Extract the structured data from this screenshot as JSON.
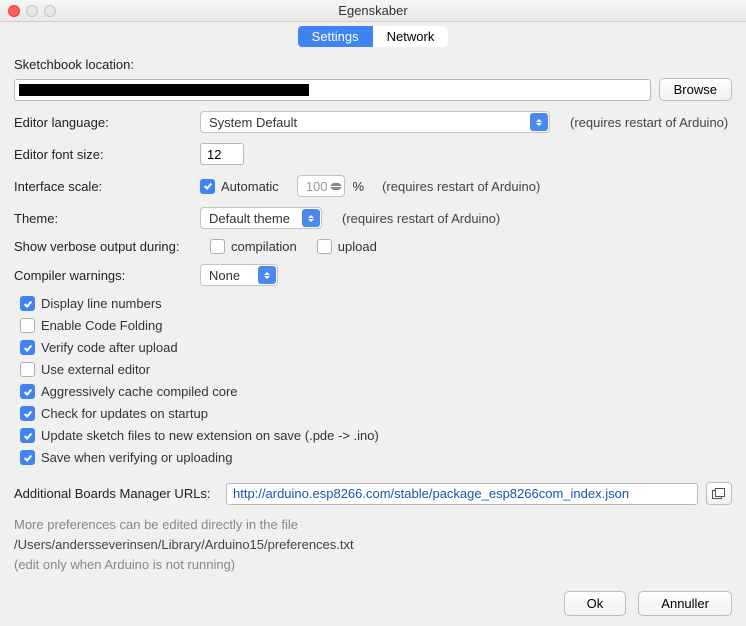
{
  "window": {
    "title": "Egenskaber"
  },
  "tabs": {
    "settings": "Settings",
    "network": "Network"
  },
  "sketchbook": {
    "label": "Sketchbook location:",
    "browse": "Browse"
  },
  "lang": {
    "label": "Editor language:",
    "value": "System Default",
    "hint": "(requires restart of Arduino)"
  },
  "font": {
    "label": "Editor font size:",
    "value": "12"
  },
  "scale": {
    "label": "Interface scale:",
    "auto_label": "Automatic",
    "pct": "100",
    "pct_suffix": "%",
    "hint": "(requires restart of Arduino)"
  },
  "theme": {
    "label": "Theme:",
    "value": "Default theme",
    "hint": "(requires restart of Arduino)"
  },
  "verbose": {
    "label": "Show verbose output during:",
    "compilation": "compilation",
    "upload": "upload"
  },
  "warnings": {
    "label": "Compiler warnings:",
    "value": "None"
  },
  "opts": {
    "line_numbers": "Display line numbers",
    "code_folding": "Enable Code Folding",
    "verify_upload": "Verify code after upload",
    "external_editor": "Use external editor",
    "cache_core": "Aggressively cache compiled core",
    "check_updates": "Check for updates on startup",
    "update_ext": "Update sketch files to new extension on save (.pde -> .ino)",
    "save_verify": "Save when verifying or uploading"
  },
  "urls": {
    "label": "Additional Boards Manager URLs:",
    "value": "http://arduino.esp8266.com/stable/package_esp8266com_index.json"
  },
  "footer": {
    "line1": "More preferences can be edited directly in the file",
    "path": "/Users/andersseverinsen/Library/Arduino15/preferences.txt",
    "line3": "(edit only when Arduino is not running)"
  },
  "buttons": {
    "ok": "Ok",
    "cancel": "Annuller"
  }
}
